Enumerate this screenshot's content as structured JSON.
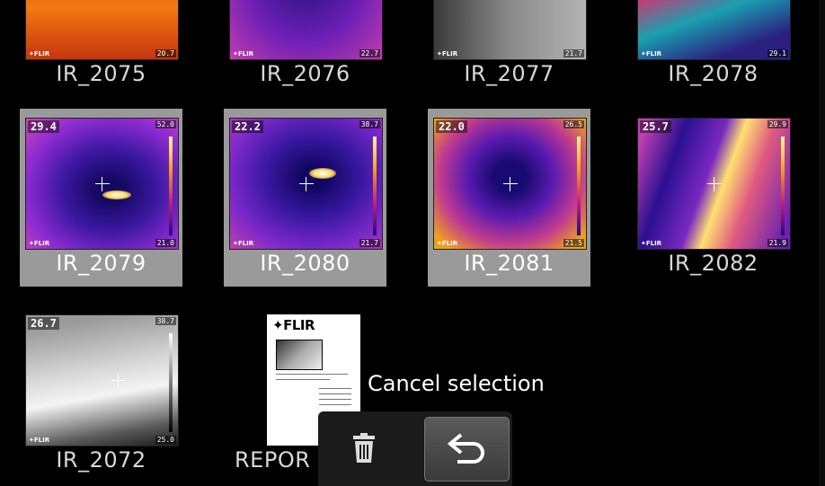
{
  "gallery": {
    "rows": [
      [
        {
          "name": "IR_2075",
          "selected": false
        },
        {
          "name": "IR_2076",
          "selected": false
        },
        {
          "name": "IR_2077",
          "selected": false
        },
        {
          "name": "IR_2078",
          "selected": false
        }
      ],
      [
        {
          "name": "IR_2079",
          "selected": true,
          "temp": "29.4",
          "hi": "52.0",
          "lo": "21.0"
        },
        {
          "name": "IR_2080",
          "selected": true,
          "temp": "22.2",
          "hi": "38.7",
          "lo": "21.7"
        },
        {
          "name": "IR_2081",
          "selected": true,
          "temp": "22.0",
          "hi": "26.5",
          "lo": "21.5"
        },
        {
          "name": "IR_2082",
          "selected": false,
          "temp": "25.7",
          "hi": "29.9",
          "lo": "21.9"
        }
      ],
      [
        {
          "name": "IR_2072",
          "selected": false,
          "temp": "26.7",
          "hi": "38.7",
          "lo": "25.0"
        },
        {
          "name": "REPOR",
          "selected": false,
          "type": "report"
        }
      ]
    ],
    "thumb_row0": {
      "t1": "20.7",
      "t2": "22.7",
      "t3": "21.7",
      "t4": "29.1"
    },
    "brand": "FLIR"
  },
  "toolbar": {
    "tooltip": "Cancel selection",
    "icons": [
      "trash-icon",
      "undo-arrow-icon"
    ]
  },
  "colors": {
    "selection": "#9a9a9a",
    "background": "#000000",
    "bar": "#1b1b1b"
  }
}
